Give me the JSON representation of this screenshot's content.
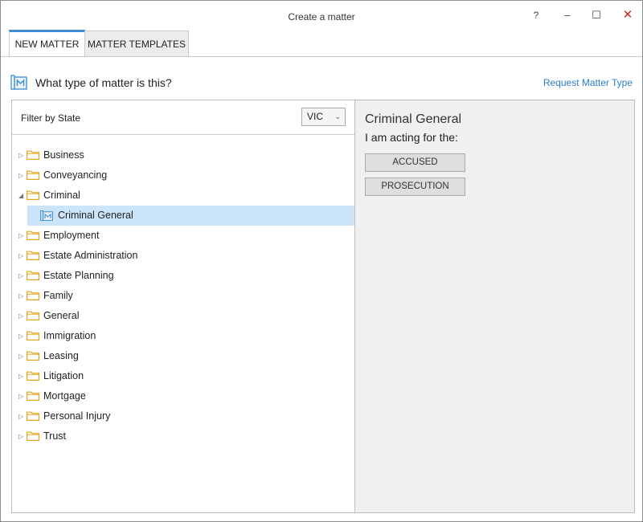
{
  "window": {
    "title": "Create a matter",
    "help_label": "?",
    "minimize_label": "–",
    "maximize_label": "☐",
    "close_label": "✕"
  },
  "tabs": [
    {
      "label": "NEW MATTER",
      "active": true
    },
    {
      "label": "MATTER TEMPLATES",
      "active": false
    }
  ],
  "header": {
    "question": "What type of matter is this?",
    "request_link": "Request Matter Type"
  },
  "filter": {
    "label": "Filter by State",
    "selected": "VIC"
  },
  "tree": {
    "items": [
      {
        "label": "Business",
        "expanded": false
      },
      {
        "label": "Conveyancing",
        "expanded": false
      },
      {
        "label": "Criminal",
        "expanded": true
      },
      {
        "label": "Employment",
        "expanded": false
      },
      {
        "label": "Estate Administration",
        "expanded": false
      },
      {
        "label": "Estate Planning",
        "expanded": false
      },
      {
        "label": "Family",
        "expanded": false
      },
      {
        "label": "General",
        "expanded": false
      },
      {
        "label": "Immigration",
        "expanded": false
      },
      {
        "label": "Leasing",
        "expanded": false
      },
      {
        "label": "Litigation",
        "expanded": false
      },
      {
        "label": "Mortgage",
        "expanded": false
      },
      {
        "label": "Personal Injury",
        "expanded": false
      },
      {
        "label": "Trust",
        "expanded": false
      }
    ],
    "selected_child": "Criminal General"
  },
  "details": {
    "title": "Criminal General",
    "subtitle": "I am acting for the:",
    "option_accused": "ACCUSED",
    "option_prosecution": "PROSECUTION"
  },
  "colors": {
    "accent": "#3a8dd4",
    "link": "#2a7fc9",
    "selection": "#cce4f7",
    "folder": "#e8a31c",
    "close": "#c42b1c"
  }
}
